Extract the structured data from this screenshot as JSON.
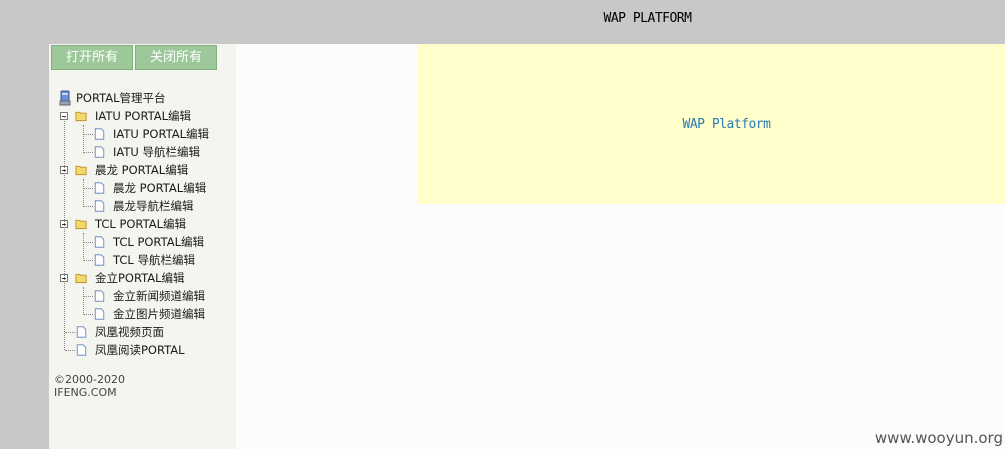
{
  "header": {
    "title": "WAP PLATFORM"
  },
  "sidebar": {
    "buttons": {
      "expand_all": "打开所有",
      "collapse_all": "关闭所有"
    },
    "tree": {
      "root": "PORTAL管理平台",
      "groups": [
        {
          "label": "IATU PORTAL编辑",
          "children": [
            "IATU PORTAL编辑",
            "IATU 导航栏编辑"
          ]
        },
        {
          "label": "晨龙  PORTAL编辑",
          "children": [
            "晨龙  PORTAL编辑",
            "晨龙导航栏编辑"
          ]
        },
        {
          "label": "TCL PORTAL编辑",
          "children": [
            "TCL PORTAL编辑",
            "TCL 导航栏编辑"
          ]
        },
        {
          "label": "金立PORTAL编辑",
          "children": [
            "金立新闻频道编辑",
            "金立图片频道编辑"
          ]
        }
      ],
      "items": [
        "凤凰视频页面",
        "凤凰阅读PORTAL"
      ]
    },
    "footer": {
      "copyright": "©2000-2020",
      "site": "IFENG.COM"
    }
  },
  "main": {
    "banner_text": "WAP Platform"
  },
  "watermark": "www.wooyun.org",
  "colors": {
    "button": "#9cc89a",
    "banner": "#ffffcc",
    "banner_text": "#2b7bb9"
  }
}
